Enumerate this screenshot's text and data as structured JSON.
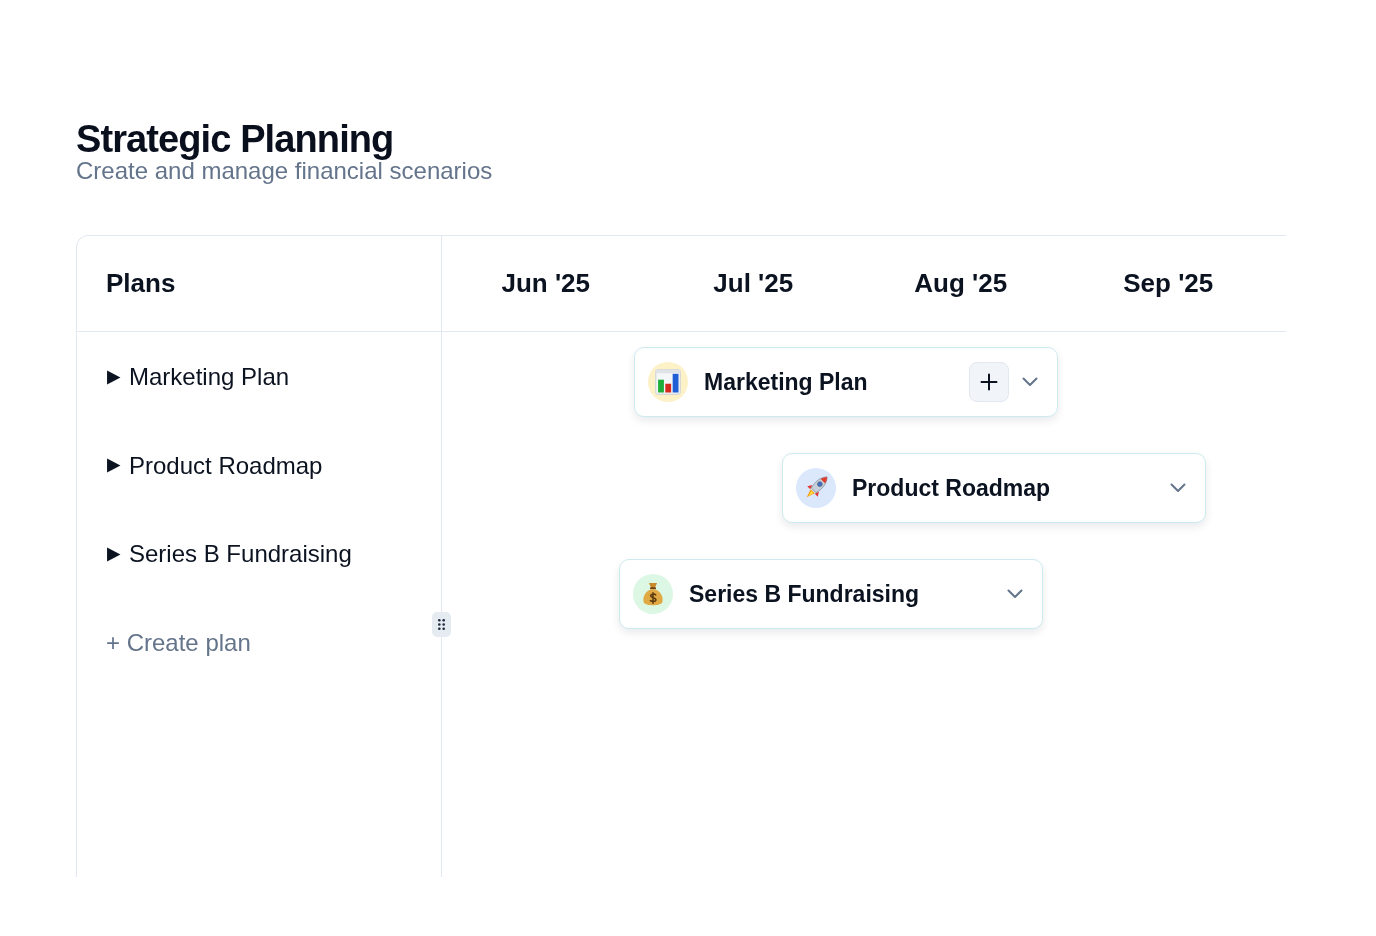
{
  "header": {
    "title": "Strategic Planning",
    "subtitle": "Create and manage financial scenarios"
  },
  "plans_panel": {
    "heading": "Plans",
    "items": [
      {
        "label": "Marketing Plan",
        "expanded": false
      },
      {
        "label": "Product Roadmap",
        "expanded": false
      },
      {
        "label": "Series B Fundraising",
        "expanded": false
      }
    ],
    "create_link": "+ Create plan"
  },
  "timeline": {
    "months": [
      "Jun '25",
      "Jul '25",
      "Aug '25",
      "Sep '25"
    ],
    "bars": [
      {
        "title": "Marketing Plan",
        "color": "#fdf1c7",
        "hovered": true
      },
      {
        "title": "Product Roadmap",
        "color": "#dbe8fc",
        "hovered": false
      },
      {
        "title": "Series B Fundraising",
        "color": "#dcf7e3",
        "hovered": false
      }
    ]
  }
}
